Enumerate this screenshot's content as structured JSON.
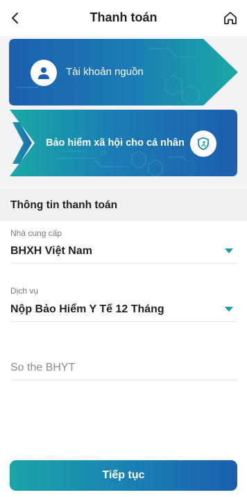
{
  "header": {
    "title": "Thanh toán",
    "back_icon": "chevron-left-icon",
    "home_icon": "home-icon"
  },
  "cards": {
    "source_label": "Tài khoản nguồn",
    "service_label": "Bảo hiểm xã hội cho cá nhân",
    "source_icon": "user-icon",
    "service_icon": "shield-icon"
  },
  "section": {
    "title": "Thông tin thanh toán"
  },
  "form": {
    "provider_label": "Nhà cung cấp",
    "provider_value": "BHXH Việt Nam",
    "service_label": "Dịch vụ",
    "service_value": "Nộp Bảo Hiểm Y Tế 12 Tháng",
    "bhyt_placeholder": "So the BHYT"
  },
  "actions": {
    "continue_label": "Tiếp tục"
  },
  "colors": {
    "accent": "#1e9aa6",
    "card_blue": "#1f5fae",
    "card_teal": "#1aa5a8"
  }
}
